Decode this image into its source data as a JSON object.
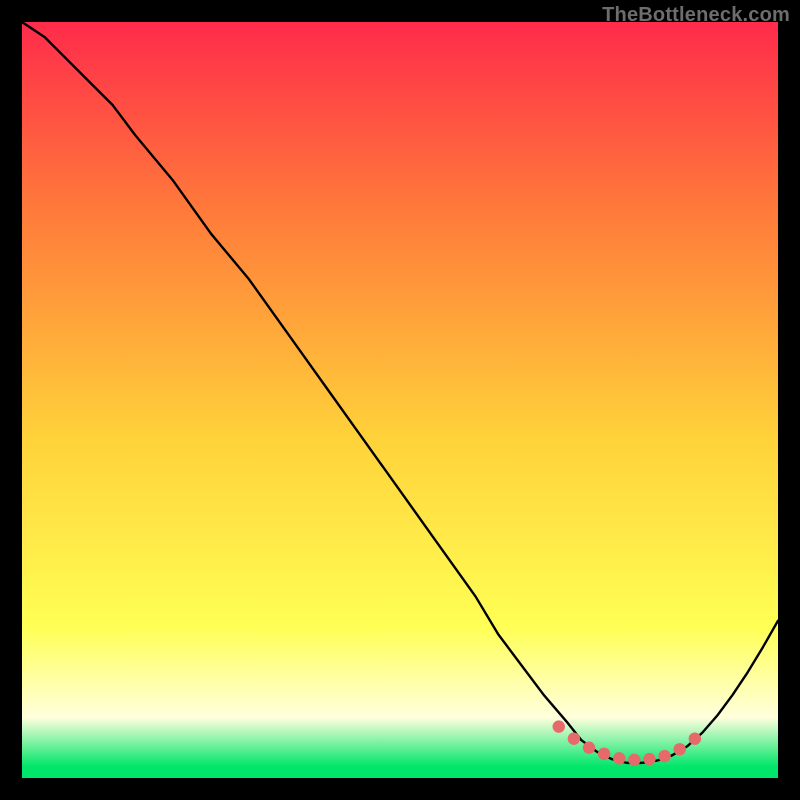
{
  "watermark": "TheBottleneck.com",
  "colors": {
    "grad_top": "#ff2b4b",
    "grad_mid_upper": "#ff7a3a",
    "grad_mid": "#ffd23a",
    "grad_lower": "#ffff55",
    "grad_pale": "#ffffdd",
    "grad_green": "#00e66a",
    "curve": "#000000",
    "dots": "#e66a6a",
    "frame_bg": "#000000"
  },
  "chart_data": {
    "type": "line",
    "title": "",
    "xlabel": "",
    "ylabel": "",
    "xlim": [
      0,
      100
    ],
    "ylim": [
      0,
      100
    ],
    "series": [
      {
        "name": "bottleneck-curve",
        "x": [
          0,
          3,
          6,
          9,
          12,
          15,
          20,
          25,
          30,
          35,
          40,
          45,
          50,
          55,
          60,
          63,
          66,
          69,
          72,
          74,
          76,
          78,
          80,
          82,
          84,
          86,
          88,
          90,
          92,
          94,
          96,
          98,
          100
        ],
        "y": [
          100,
          98,
          95,
          92,
          89,
          85,
          79,
          72,
          66,
          59,
          52,
          45,
          38,
          31,
          24,
          19,
          15,
          11,
          7.5,
          5,
          3.5,
          2.5,
          2,
          2,
          2.3,
          3,
          4.2,
          6,
          8.3,
          11,
          14,
          17.3,
          20.8
        ]
      },
      {
        "name": "optimal-zone-dots",
        "x": [
          71,
          73,
          75,
          77,
          79,
          81,
          83,
          85,
          87,
          89
        ],
        "y": [
          6.8,
          5.2,
          4,
          3.2,
          2.6,
          2.4,
          2.5,
          2.9,
          3.8,
          5.2
        ]
      }
    ],
    "gradient_stops": [
      {
        "offset": 0.0,
        "color_key": "grad_top"
      },
      {
        "offset": 0.25,
        "color_key": "grad_mid_upper"
      },
      {
        "offset": 0.55,
        "color_key": "grad_mid"
      },
      {
        "offset": 0.8,
        "color_key": "grad_lower"
      },
      {
        "offset": 0.92,
        "color_key": "grad_pale"
      },
      {
        "offset": 0.985,
        "color_key": "grad_green"
      },
      {
        "offset": 1.0,
        "color_key": "grad_green"
      }
    ]
  }
}
